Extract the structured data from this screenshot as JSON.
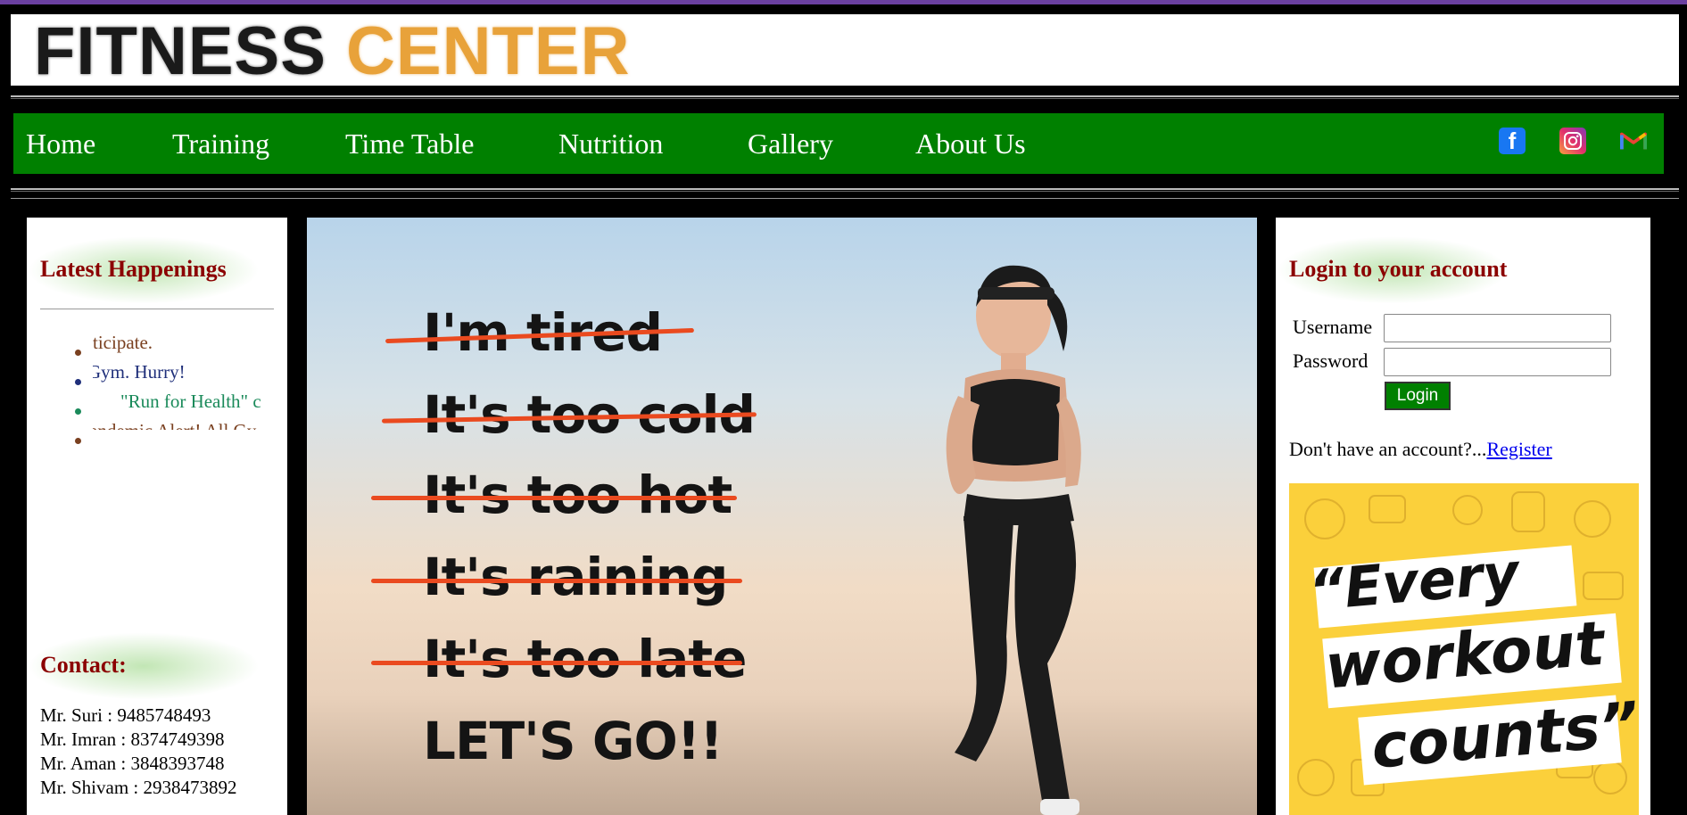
{
  "header": {
    "logo_part1": "FITNESS",
    "logo_part2": "CENTER"
  },
  "nav": {
    "items": [
      "Home",
      "Training",
      "Time Table",
      "Nutrition",
      "Gallery",
      "About Us"
    ],
    "social": [
      "facebook-icon",
      "instagram-icon",
      "gmail-icon"
    ],
    "bg_color": "#008000"
  },
  "left": {
    "happenings_title": "Latest Happenings",
    "marquee_items": [
      {
        "text": "ticipate.",
        "color": "#7a4020"
      },
      {
        "text": "Gym. Hurry!",
        "color": "#1f2f7a"
      },
      {
        "text": "\"Run for Health\" c",
        "color": "#1a8a5a"
      },
      {
        "text": "andemic Alert! All Gy",
        "color": "#7a4020"
      }
    ],
    "contact_title": "Contact:",
    "contacts": [
      "Mr. Suri : 9485748493",
      "Mr. Imran : 8374749398",
      "Mr. Aman : 3848393748",
      "Mr. Shivam : 2938473892"
    ]
  },
  "center": {
    "phrases": [
      "I'm tired",
      "It's too cold",
      "It's too hot",
      "It's raining",
      "It's too late",
      "LET'S GO!!"
    ]
  },
  "right": {
    "login_title": "Login to your account",
    "username_label": "Username",
    "password_label": "Password",
    "username_value": "",
    "password_value": "",
    "login_button": "Login",
    "register_prompt": "Don't have an account?...",
    "register_link": "Register",
    "quote": [
      "“Every",
      "workout",
      "counts”"
    ]
  },
  "colors": {
    "title_red": "#8b0000",
    "strike_orange": "#ea4a1f",
    "quote_yellow": "#fbd03b"
  }
}
